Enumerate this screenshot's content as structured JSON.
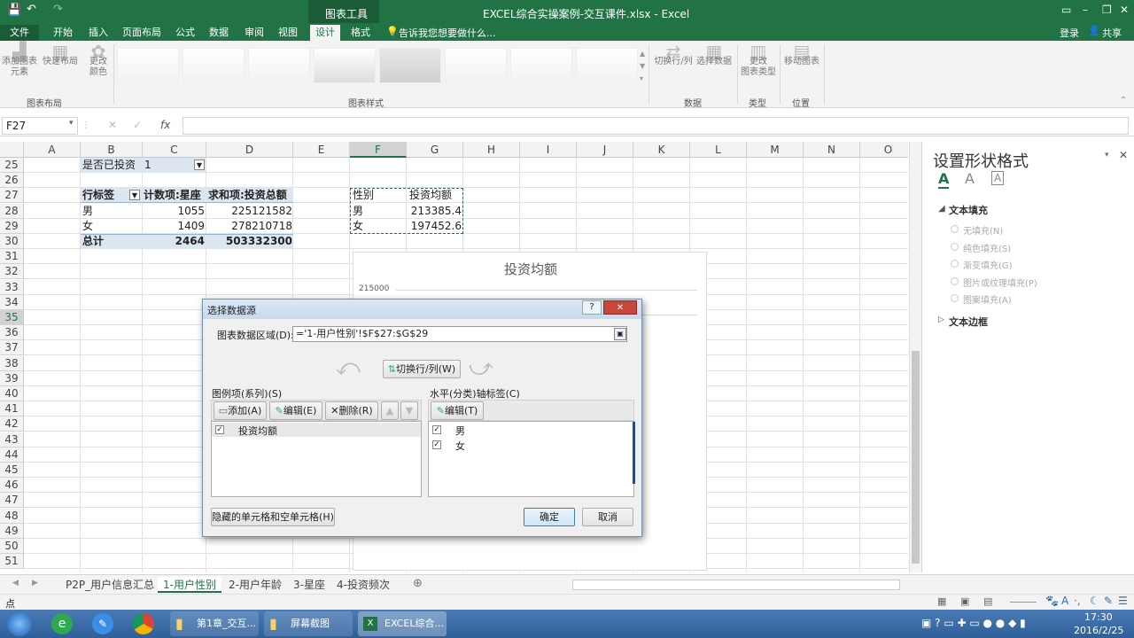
{
  "window": {
    "title": "EXCEL综合实操案例-交互课件.xlsx - Excel",
    "context_tool": "图表工具",
    "controls": [
      "?",
      "□",
      "–",
      "□",
      "✕"
    ]
  },
  "ribbon_tabs": [
    {
      "label": "文件",
      "active": false
    },
    {
      "label": "开始",
      "active": false
    },
    {
      "label": "插入",
      "active": false
    },
    {
      "label": "页面布局",
      "active": false
    },
    {
      "label": "公式",
      "active": false
    },
    {
      "label": "数据",
      "active": false
    },
    {
      "label": "审阅",
      "active": false
    },
    {
      "label": "视图",
      "active": false
    },
    {
      "label": "设计",
      "active": true
    },
    {
      "label": "格式",
      "active": false
    }
  ],
  "tell_me": "告诉我您想要做什么...",
  "signin": "登录",
  "share": "共享",
  "ribbon": {
    "add_element": "添加图表\n元素",
    "quick_layout": "快速布局",
    "change_color": "更改\n颜色",
    "switch_rowcol": "切换行/列",
    "select_data": "选择数据",
    "change_type": "更改\n图表类型",
    "move_chart": "移动图表",
    "group_layout": "图表布局",
    "group_styles": "图表样式",
    "group_data": "数据",
    "group_type": "类型",
    "group_location": "位置"
  },
  "formula_bar": {
    "name_box": "F27",
    "fx": "fx",
    "content": ""
  },
  "columns": [
    "A",
    "B",
    "C",
    "D",
    "E",
    "F",
    "G",
    "H",
    "I",
    "J",
    "K",
    "L",
    "M",
    "N",
    "O"
  ],
  "rows": [
    "25",
    "26",
    "27",
    "28",
    "29",
    "30",
    "31",
    "32",
    "33",
    "34",
    "35",
    "36",
    "37",
    "38",
    "39",
    "40",
    "41",
    "42",
    "43",
    "44",
    "45",
    "46",
    "47",
    "48",
    "49",
    "50",
    "51"
  ],
  "pivot": {
    "filter_label": "是否已投资",
    "filter_value": "1",
    "headers": [
      "行标签",
      "计数项:星座",
      "求和项:投资总额"
    ],
    "rows": [
      {
        "label": "男",
        "count": "1055",
        "sum": "225121582"
      },
      {
        "label": "女",
        "count": "1409",
        "sum": "278210718"
      }
    ],
    "total": {
      "label": "总计",
      "count": "2464",
      "sum": "503332300"
    }
  },
  "avg_table": {
    "headers": [
      "性别",
      "投资均额"
    ],
    "rows": [
      {
        "label": "男",
        "value": "213385.4"
      },
      {
        "label": "女",
        "value": "197452.6"
      }
    ]
  },
  "chart": {
    "title": "投资均额",
    "y_tick": "215000"
  },
  "dialog": {
    "title": "选择数据源",
    "range_label": "图表数据区域(D):",
    "range_value": "='1-用户性别'!$F$27:$G$29",
    "switch_btn": "切换行/列(W)",
    "series_label": "图例项(系列)(S)",
    "add_btn": "添加(A)",
    "edit_btn": "编辑(E)",
    "delete_btn": "删除(R)",
    "series": [
      "投资均额"
    ],
    "axis_label": "水平(分类)轴标签(C)",
    "axis_edit_btn": "编辑(T)",
    "axis_items": [
      "男",
      "女"
    ],
    "hidden_btn": "隐藏的单元格和空单元格(H)",
    "ok": "确定",
    "cancel": "取消"
  },
  "pane": {
    "title": "设置形状格式",
    "text_fill": "文本填充",
    "options": [
      "无填充(N)",
      "纯色填充(S)",
      "渐变填充(G)",
      "图片或纹理填充(P)",
      "图案填充(A)"
    ],
    "text_border": "文本边框"
  },
  "sheet_tabs": [
    {
      "label": "P2P_用户信息汇总",
      "active": false
    },
    {
      "label": "1-用户性别",
      "active": true
    },
    {
      "label": "2-用户年龄",
      "active": false
    },
    {
      "label": "3-星座",
      "active": false
    },
    {
      "label": "4-投资频次",
      "active": false
    }
  ],
  "status": {
    "mode": "点"
  },
  "taskbar": {
    "items": [
      "第1章_交互...",
      "屏幕截图",
      "EXCEL综合..."
    ],
    "time": "17:30",
    "date": "2016/2/25"
  },
  "colors": {
    "accent": "#217346",
    "taskbar": "#2f5f98"
  }
}
